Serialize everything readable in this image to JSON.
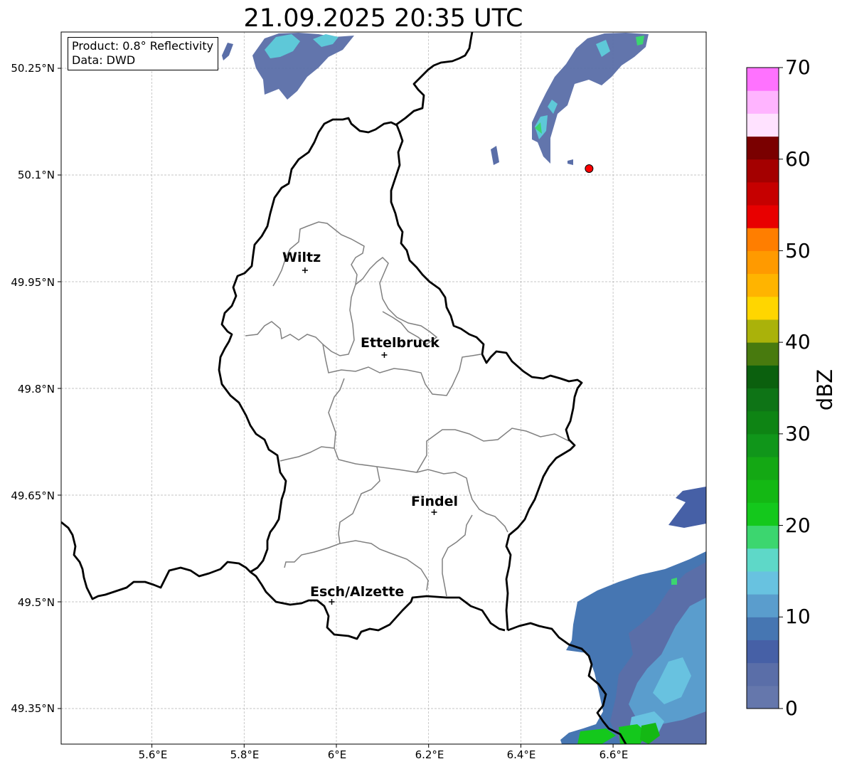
{
  "title": "21.09.2025 20:35 UTC",
  "info_box": {
    "product": "Product: 0.8° Reflectivity",
    "data_source": "Data: DWD"
  },
  "map": {
    "lon_range": [
      5.4,
      6.8
    ],
    "lat_range": [
      49.3,
      50.3
    ],
    "lat_ticks": [
      "50.25°N",
      "50.1°N",
      "49.95°N",
      "49.8°N",
      "49.65°N",
      "49.5°N",
      "49.35°N"
    ],
    "lon_ticks": [
      "5.6°E",
      "5.8°E",
      "6°E",
      "6.2°E",
      "6.4°E",
      "6.6°E"
    ],
    "gridlines": true,
    "cities": [
      {
        "name": "Wiltz",
        "lon": 5.932,
        "lat": 49.966
      },
      {
        "name": "Ettelbruck",
        "lon": 6.104,
        "lat": 49.847
      },
      {
        "name": "Findel",
        "lon": 6.212,
        "lat": 49.626
      },
      {
        "name": "Esch/Alzette",
        "lon": 5.99,
        "lat": 49.5
      }
    ],
    "radar_site": {
      "lon": 6.548,
      "lat": 50.109,
      "color": "#ff0000"
    }
  },
  "colorbar": {
    "label": "dBZ",
    "ticks": [
      "0",
      "10",
      "20",
      "30",
      "40",
      "50",
      "60",
      "70"
    ],
    "min": 0,
    "max": 70,
    "step": 2.5,
    "colors": [
      "#6577ac",
      "#5a6ea8",
      "#4660a6",
      "#4676b2",
      "#5a9dcd",
      "#68c2e0",
      "#5ed8c8",
      "#3cd66f",
      "#14c81c",
      "#14b814",
      "#14a814",
      "#10961a",
      "#0e8414",
      "#0e7416",
      "#0b600e",
      "#487a0e",
      "#aab20a",
      "#ffd600",
      "#ffb400",
      "#ff9a00",
      "#ff7e00",
      "#e80000",
      "#c60000",
      "#a40000",
      "#7a0000",
      "#ffe2ff",
      "#ffb4ff",
      "#ff72ff",
      "#e436ec"
    ]
  }
}
